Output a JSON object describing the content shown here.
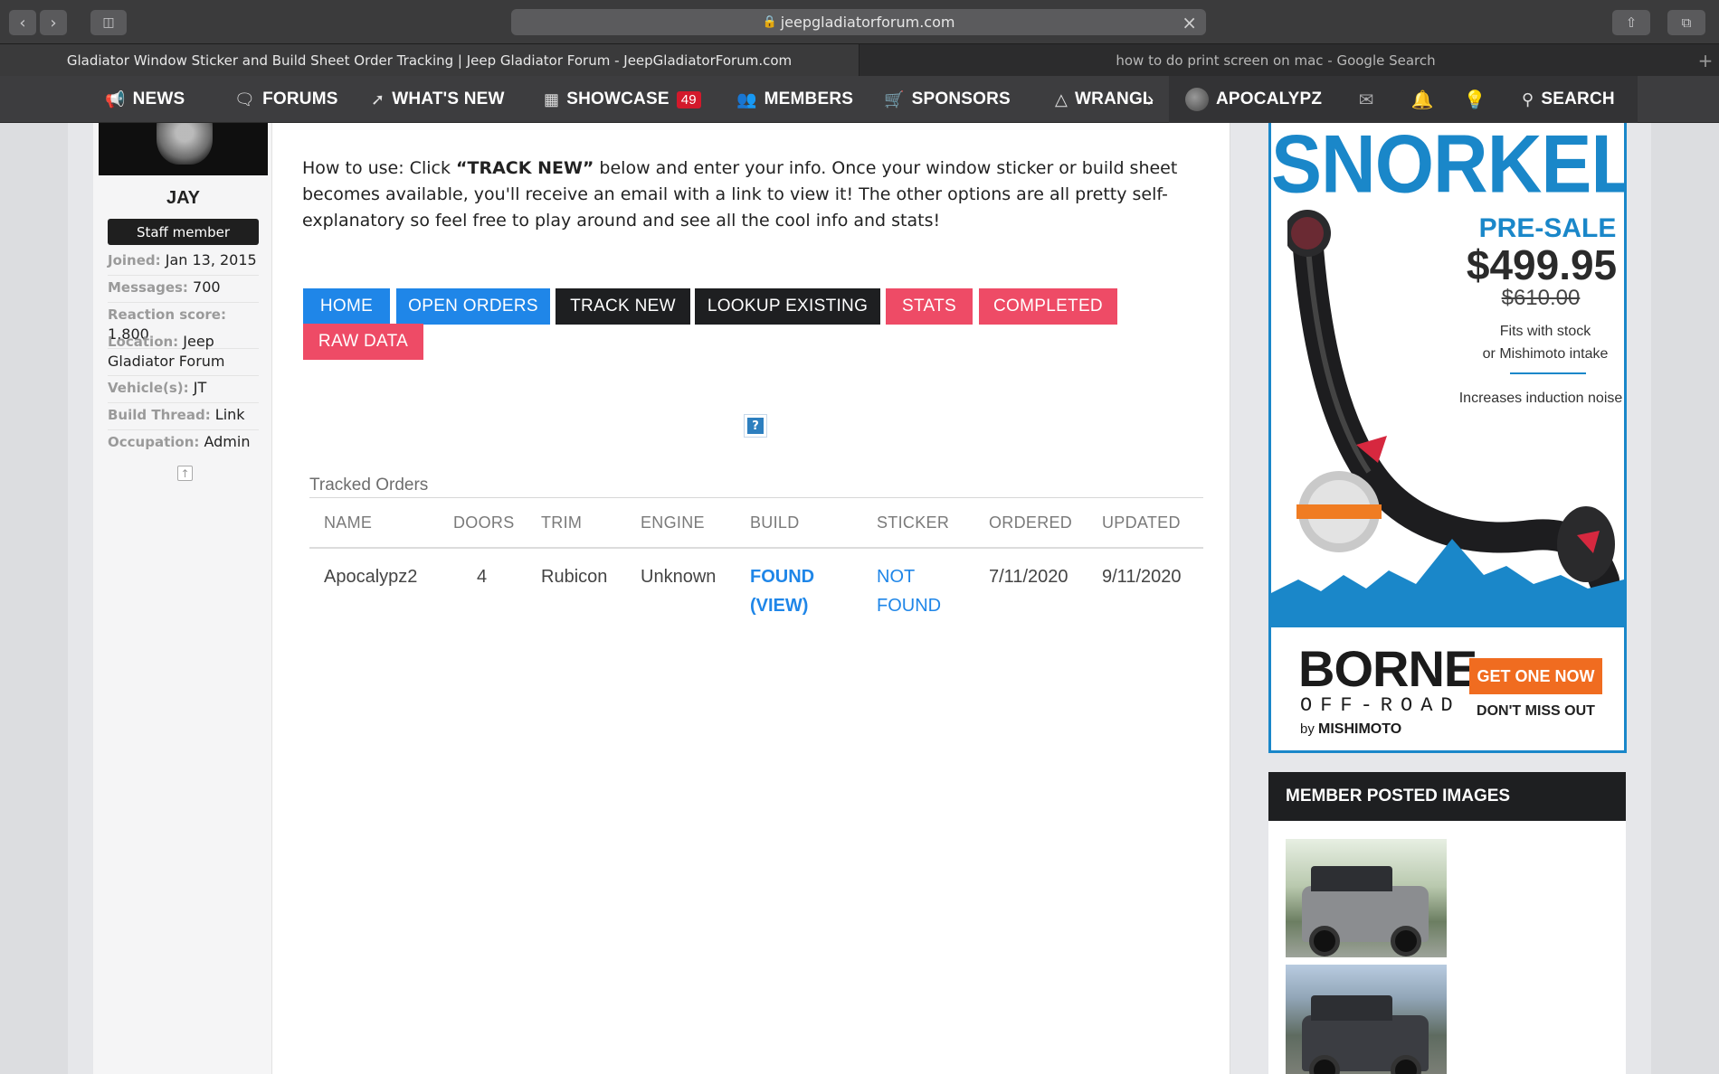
{
  "browser": {
    "url": "jeepgladiatorforum.com",
    "tabs": [
      {
        "label": "Gladiator Window Sticker and Build Sheet Order Tracking | Jeep Gladiator Forum - JeepGladiatorForum.com"
      },
      {
        "label": "how to do print screen on mac - Google Search"
      }
    ]
  },
  "sitenav": {
    "items": [
      {
        "label": "NEWS",
        "icon": "megaphone-icon"
      },
      {
        "label": "FORUMS",
        "icon": "chat-bubbles-icon"
      },
      {
        "label": "WHAT'S NEW",
        "icon": "bolt-icon"
      },
      {
        "label": "SHOWCASE",
        "icon": "grid-icon",
        "badge": "49"
      },
      {
        "label": "MEMBERS",
        "icon": "users-icon"
      },
      {
        "label": "SPONSORS",
        "icon": "cart-icon"
      },
      {
        "label": "WRANGL",
        "icon": "mountain-icon"
      }
    ],
    "user": "APOCALYPZ",
    "search_label": "SEARCH"
  },
  "sidebar": {
    "name": "JAY",
    "title": "Staff member",
    "info": [
      {
        "label": "Joined:",
        "value": "Jan 13, 2015"
      },
      {
        "label": "Messages:",
        "value": "700"
      },
      {
        "label": "Reaction score:",
        "value": "1,800"
      },
      {
        "label": "Location:",
        "value": "Jeep Gladiator Forum"
      },
      {
        "label": "Vehicle(s):",
        "value": "JT"
      },
      {
        "label": "Build Thread:",
        "value": "Link"
      },
      {
        "label": "Occupation:",
        "value": "Admin"
      }
    ]
  },
  "main": {
    "intro_prefix": "How to use: Click ",
    "intro_bold": "“TRACK NEW”",
    "intro_suffix": " below and enter your info. Once your window sticker or build sheet becomes available, you'll receive an email with a link to view it! The other options are all pretty self-explanatory so feel free to play around and see all the cool info and stats!",
    "buttons": [
      "HOME",
      "OPEN ORDERS",
      "TRACK NEW",
      "LOOKUP EXISTING",
      "STATS",
      "COMPLETED",
      "RAW DATA"
    ],
    "help_glyph": "?",
    "table": {
      "title": "Tracked Orders",
      "headers": [
        "NAME",
        "DOORS",
        "TRIM",
        "ENGINE",
        "BUILD",
        "STICKER",
        "ORDERED",
        "UPDATED"
      ],
      "rows": [
        {
          "name": "Apocalypz2",
          "doors": "4",
          "trim": "Rubicon",
          "engine": "Unknown",
          "build_line1": "FOUND",
          "build_line2": "(VIEW)",
          "sticker_line1": "NOT",
          "sticker_line2": "FOUND",
          "ordered": "7/11/2020",
          "updated": "9/11/2020"
        }
      ]
    }
  },
  "ad": {
    "headline": "SNORKEL",
    "presale": "PRE-SALE",
    "price": "$499.95",
    "old_price": "$610.00",
    "fits_line1": "Fits with stock",
    "fits_line2": "or Mishimoto intake",
    "induction": "Increases induction noise",
    "brand": "BORNE",
    "brand_sub": "OFF-ROAD",
    "by": "by",
    "by_brand": "MISHIMOTO",
    "cta": "GET ONE NOW",
    "dont_miss": "DON'T MISS OUT",
    "colors": {
      "accent": "#1a87c9",
      "cta": "#f06c20"
    }
  },
  "member_images": {
    "title": "MEMBER POSTED IMAGES"
  },
  "colors": {
    "btn_blue": "#1f86e8",
    "btn_dark": "#1e1f21",
    "btn_red": "#ee4b66",
    "link": "#1f86e8",
    "badge": "#d3192b"
  }
}
